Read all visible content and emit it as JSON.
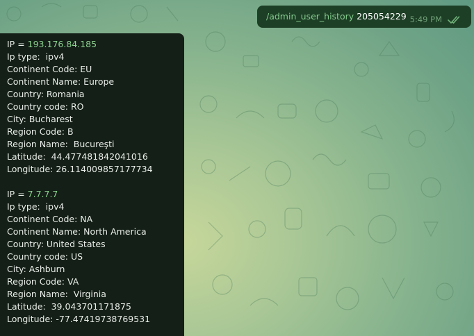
{
  "outgoing_message": {
    "command": "/admin_user_history",
    "argument": " 205054229",
    "time": "5:49 PM",
    "status_icon": "double-check-icon",
    "colors": {
      "bubble": "#1d3f25",
      "link": "#84c98e",
      "meta": "#6f9f78"
    }
  },
  "incoming_message": {
    "records": [
      {
        "ip_label": "IP = ",
        "ip": "193.176.84.185",
        "lines": [
          "Ip type:  ipv4",
          "Continent Code: EU",
          "Continent Name: Europe",
          "Country: Romania",
          "Country code: RO",
          "City: Bucharest",
          "Region Code: B",
          "Region Name:  Bucureşti",
          "Latitude:  44.477481842041016",
          "Longitude: 26.114009857177734"
        ]
      },
      {
        "ip_label": "IP = ",
        "ip": "7.7.7.7",
        "lines": [
          "Ip type:  ipv4",
          "Continent Code: NA",
          "Continent Name: North America",
          "Country: United States",
          "Country code: US",
          "City: Ashburn",
          "Region Code: VA",
          "Region Name:  Virginia",
          "Latitude:  39.043701171875",
          "Longitude: -77.47419738769531"
        ]
      }
    ],
    "colors": {
      "bubble": "#141f17",
      "text": "#e9ede9",
      "link": "#8cd18f"
    }
  }
}
